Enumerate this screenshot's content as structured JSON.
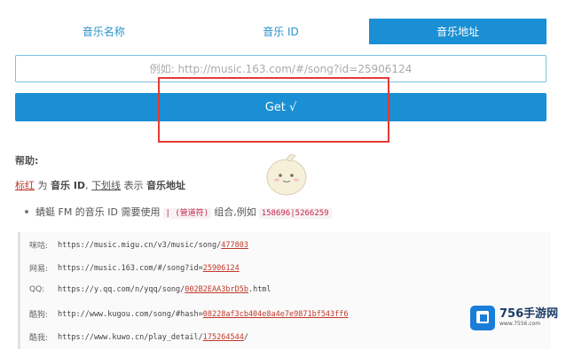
{
  "tabs": [
    {
      "label": "音乐名称"
    },
    {
      "label": "音乐 ID"
    },
    {
      "label": "音乐地址"
    }
  ],
  "input": {
    "placeholder": "例如: http://music.163.com/#/song?id=25906124",
    "value": ""
  },
  "get_button": {
    "label": "Get √"
  },
  "help": {
    "title": "帮助:",
    "legend": {
      "red_text": "标红",
      "word_for": "为",
      "music_id": "音乐 ID",
      "sep": ",",
      "underline_text": "下划线",
      "word_means": "表示",
      "music_url": "音乐地址"
    },
    "tip": {
      "prefix": "蜻蜓 FM 的音乐 ID 需要使用",
      "pipe_code": "|",
      "pipe_name": "(管道符)",
      "middle": "组合,例如",
      "example_code": "158696|5266259"
    }
  },
  "examples": [
    {
      "label": "咪咕:",
      "url_prefix": "https://music.migu.cn/v3/music/song/",
      "url_highlight": "477803"
    },
    {
      "label": "网易:",
      "url_prefix": "https://music.163.com/#/song?id=",
      "url_highlight": "25906124"
    },
    {
      "label": "QQ:",
      "url_prefix": "https://y.qq.com/n/yqq/song/",
      "url_highlight": "002B2EAA3brD5b",
      "url_suffix": ".html"
    },
    {
      "label": "酷狗:",
      "url_prefix": "http://www.kugou.com/song/#hash=",
      "url_highlight": "08228af3cb404e8a4e7e9871bf543ff6"
    },
    {
      "label": "酷我:",
      "url_prefix": "https://www.kuwo.cn/play_detail/",
      "url_highlight": "175264544",
      "url_suffix": "/"
    }
  ],
  "watermark": {
    "brand": "756手游网",
    "sub": "www.7556.com"
  },
  "colors": {
    "primary": "#1a8fd3",
    "highlight_border": "#e53935",
    "red_text": "#c0392b"
  }
}
